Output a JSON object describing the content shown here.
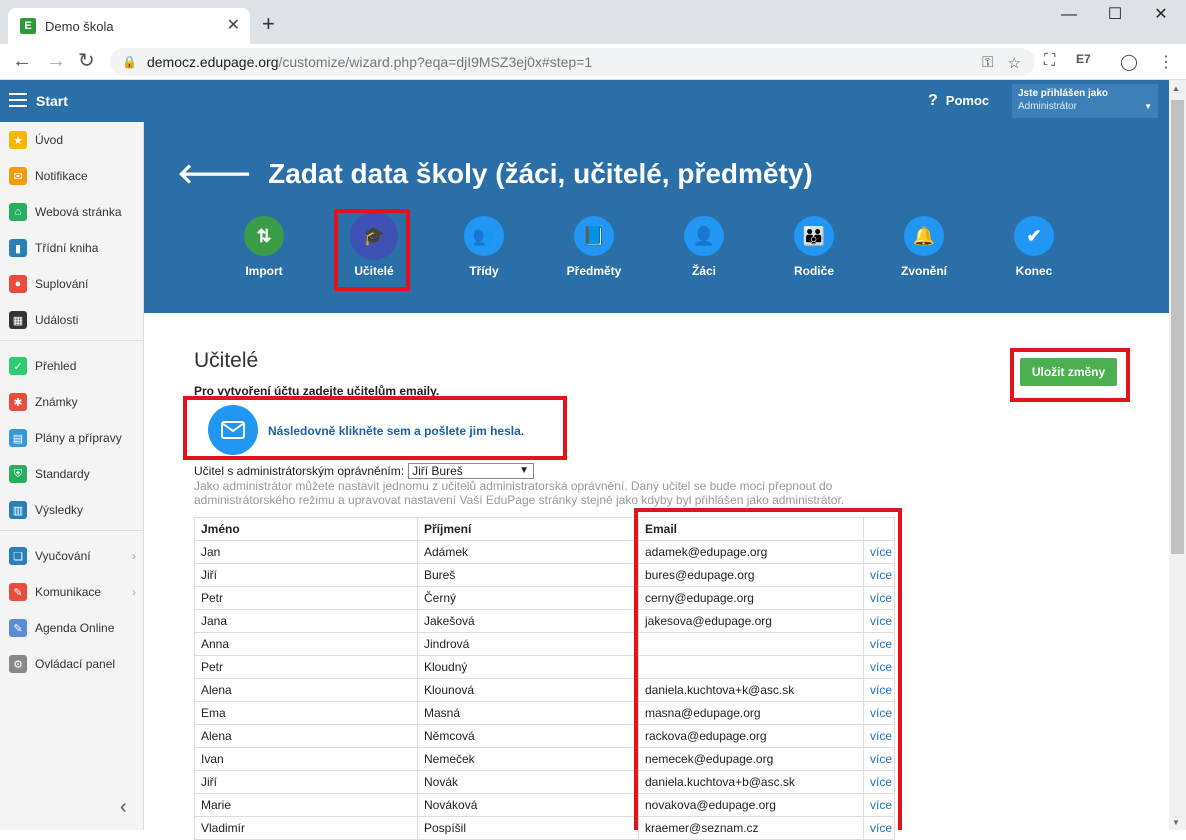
{
  "browser": {
    "tab_title": "Demo škola",
    "favicon_letter": "E",
    "url_host": "democz.edupage.org",
    "url_path": "/customize/wizard.php?eqa=djI9MSZ3ej0x#step=1"
  },
  "appbar": {
    "title": "Start",
    "help_label": "Pomoc",
    "user_line1": "Jste přihlášen jako",
    "user_line2": "Administrátor"
  },
  "sidebar": {
    "items": [
      {
        "label": "Úvod",
        "icon": "star-icon",
        "color": "#f7b500"
      },
      {
        "label": "Notifikace",
        "icon": "mail-icon",
        "color": "#f39c12"
      },
      {
        "label": "Webová stránka",
        "icon": "home-icon",
        "color": "#27ae60"
      },
      {
        "label": "Třídní kniha",
        "icon": "book-icon",
        "color": "#2980b9"
      },
      {
        "label": "Suplování",
        "icon": "person-icon",
        "color": "#e74c3c"
      },
      {
        "label": "Události",
        "icon": "calendar-icon",
        "color": "#333333"
      },
      {
        "label": "Přehled",
        "icon": "check-icon",
        "color": "#2ecc71"
      },
      {
        "label": "Známky",
        "icon": "grade-icon",
        "color": "#e74c3c"
      },
      {
        "label": "Plány a přípravy",
        "icon": "briefcase-icon",
        "color": "#3498db"
      },
      {
        "label": "Standardy",
        "icon": "shield-icon",
        "color": "#27ae60"
      },
      {
        "label": "Výsledky",
        "icon": "bar-chart-icon",
        "color": "#2980b9"
      },
      {
        "label": "Vyučování",
        "icon": "open-book-icon",
        "color": "#2980b9"
      },
      {
        "label": "Komunikace",
        "icon": "chat-icon",
        "color": "#e74c3c"
      },
      {
        "label": "Agenda Online",
        "icon": "pen-icon",
        "color": "#5b8dd6"
      },
      {
        "label": "Ovládací panel",
        "icon": "gear-icon",
        "color": "#888888"
      }
    ]
  },
  "hero": {
    "title": "Zadat data školy (žáci, učitelé, předměty)",
    "steps": [
      {
        "label": "Import",
        "color": "#3a9c46",
        "glyph": "⇅"
      },
      {
        "label": "Učitelé",
        "color": "#3f51b5",
        "glyph": "🎓"
      },
      {
        "label": "Třídy",
        "color": "#2196f3",
        "glyph": "👥"
      },
      {
        "label": "Předměty",
        "color": "#2196f3",
        "glyph": "📘"
      },
      {
        "label": "Žáci",
        "color": "#2196f3",
        "glyph": "👤"
      },
      {
        "label": "Rodiče",
        "color": "#2196f3",
        "glyph": "👪"
      },
      {
        "label": "Zvonění",
        "color": "#2196f3",
        "glyph": "🔔"
      },
      {
        "label": "Konec",
        "color": "#2196f3",
        "glyph": "✔"
      }
    ]
  },
  "content": {
    "title": "Učitelé",
    "save_label": "Uložit změny",
    "subtitle": "Pro vytvoření účtu zadejte učitelům emaily.",
    "mail_link": "Následovně klikněte sem a pošlete jim hesla.",
    "admin_label": "Učitel s administrátorským oprávněním:",
    "admin_value": "Jiří Bureš",
    "admin_note": "Jako administrátor můžete nastavit jednomu z učitelů administratorská oprávnění. Daný učitel se bude moci přepnout do administrátorského režimu a upravovat nastavení Vaší EduPage stránky stejně jako kdyby byl přihlášen jako administrátor."
  },
  "table": {
    "headers": [
      "Jméno",
      "Příjmení",
      "Email",
      ""
    ],
    "more_label": "více",
    "rows": [
      [
        "Jan",
        "Adámek",
        "adamek@edupage.org"
      ],
      [
        "Jiří",
        "Bureš",
        "bures@edupage.org"
      ],
      [
        "Petr",
        "Černý",
        "cerny@edupage.org"
      ],
      [
        "Jana",
        "Jakešová",
        "jakesova@edupage.org"
      ],
      [
        "Anna",
        "Jindrová",
        ""
      ],
      [
        "Petr",
        "Kloudný",
        ""
      ],
      [
        "Alena",
        "Klounová",
        "daniela.kuchtova+k@asc.sk"
      ],
      [
        "Ema",
        "Masná",
        "masna@edupage.org"
      ],
      [
        "Alena",
        "Němcová",
        "rackova@edupage.org"
      ],
      [
        "Ivan",
        "Nemeček",
        "nemecek@edupage.org"
      ],
      [
        "Jiří",
        "Novák",
        "daniela.kuchtova+b@asc.sk"
      ],
      [
        "Marie",
        "Nováková",
        "novakova@edupage.org"
      ],
      [
        "Vladimír",
        "Pospíšil",
        "kraemer@seznam.cz"
      ]
    ]
  }
}
